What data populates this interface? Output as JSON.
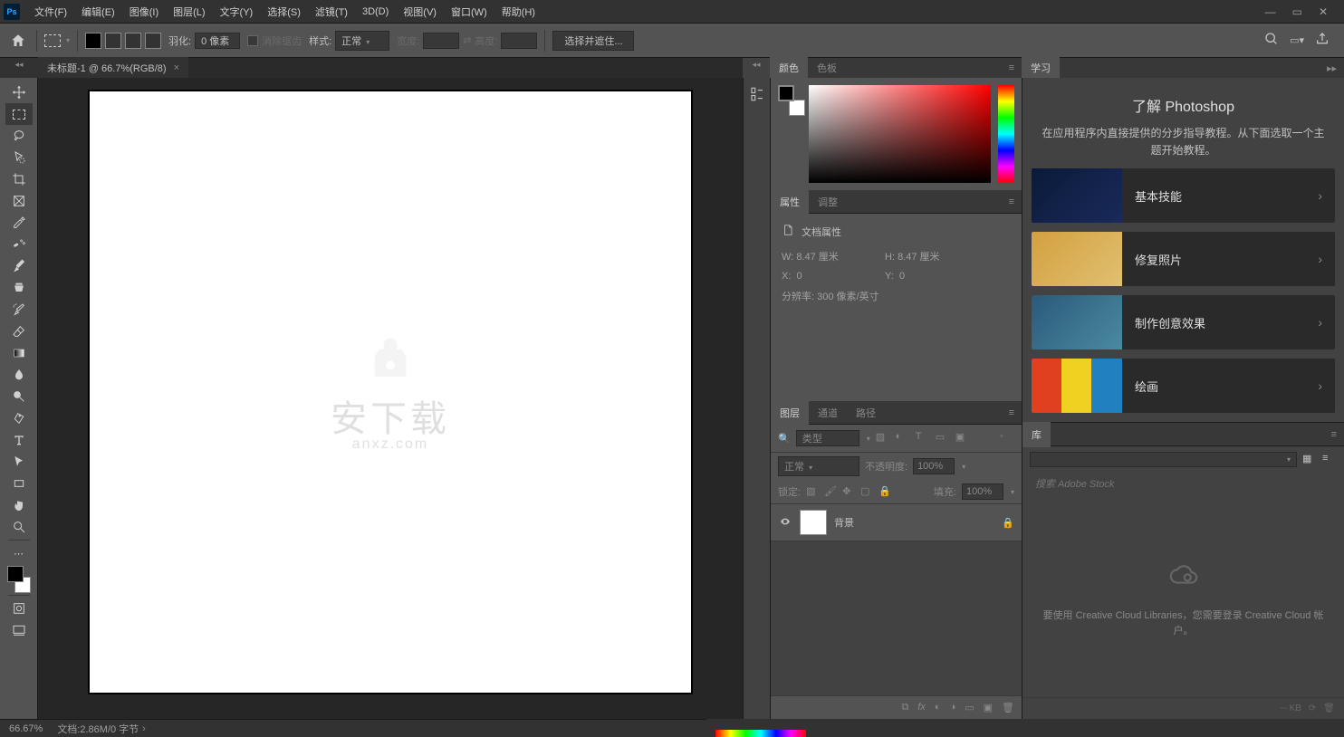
{
  "app": {
    "logo_text": "Ps"
  },
  "menu": {
    "file": "文件(F)",
    "edit": "编辑(E)",
    "image": "图像(I)",
    "layer": "图层(L)",
    "type": "文字(Y)",
    "select": "选择(S)",
    "filter": "滤镜(T)",
    "threed": "3D(D)",
    "view": "视图(V)",
    "window": "窗口(W)",
    "help": "帮助(H)"
  },
  "options": {
    "feather_label": "羽化:",
    "feather_value": "0 像素",
    "antialias_label": "消除锯齿",
    "style_label": "样式:",
    "style_value": "正常",
    "width_label": "宽度:",
    "height_label": "高度:",
    "select_mask": "选择并遮住..."
  },
  "doc_tab": {
    "title": "未标题-1 @ 66.7%(RGB/8)",
    "close": "×"
  },
  "panels": {
    "color_tab": "颜色",
    "swatches_tab": "色板",
    "properties_tab": "属性",
    "adjustments_tab": "调整",
    "layers_tab": "图层",
    "channels_tab": "通道",
    "paths_tab": "路径",
    "learn_tab": "学习",
    "library_tab": "库"
  },
  "properties": {
    "header": "文档属性",
    "w_label": "W:",
    "w_value": "8.47 厘米",
    "h_label": "H:",
    "h_value": "8.47 厘米",
    "x_label": "X:",
    "x_value": "0",
    "y_label": "Y:",
    "y_value": "0",
    "res_label": "分辨率:",
    "res_value": "300 像素/英寸"
  },
  "layers": {
    "filter_placeholder": "类型",
    "blend_mode": "正常",
    "opacity_label": "不透明度:",
    "opacity_value": "100%",
    "lock_label": "锁定:",
    "fill_label": "填充:",
    "fill_value": "100%",
    "layer_bg_name": "背景"
  },
  "learn": {
    "title": "了解 Photoshop",
    "desc": "在应用程序内直接提供的分步指导教程。从下面选取一个主题开始教程。",
    "items": [
      "基本技能",
      "修复照片",
      "制作创意效果",
      "绘画"
    ]
  },
  "library": {
    "search_placeholder": "搜索 Adobe Stock",
    "empty_text": "要使用 Creative Cloud Libraries，您需要登录 Creative Cloud 帐户。",
    "footer_kb": "-- KB"
  },
  "status": {
    "zoom": "66.67%",
    "doc_info": "文档:2.86M/0 字节"
  },
  "watermark": {
    "main": "安下载",
    "sub": "anxz.com"
  }
}
